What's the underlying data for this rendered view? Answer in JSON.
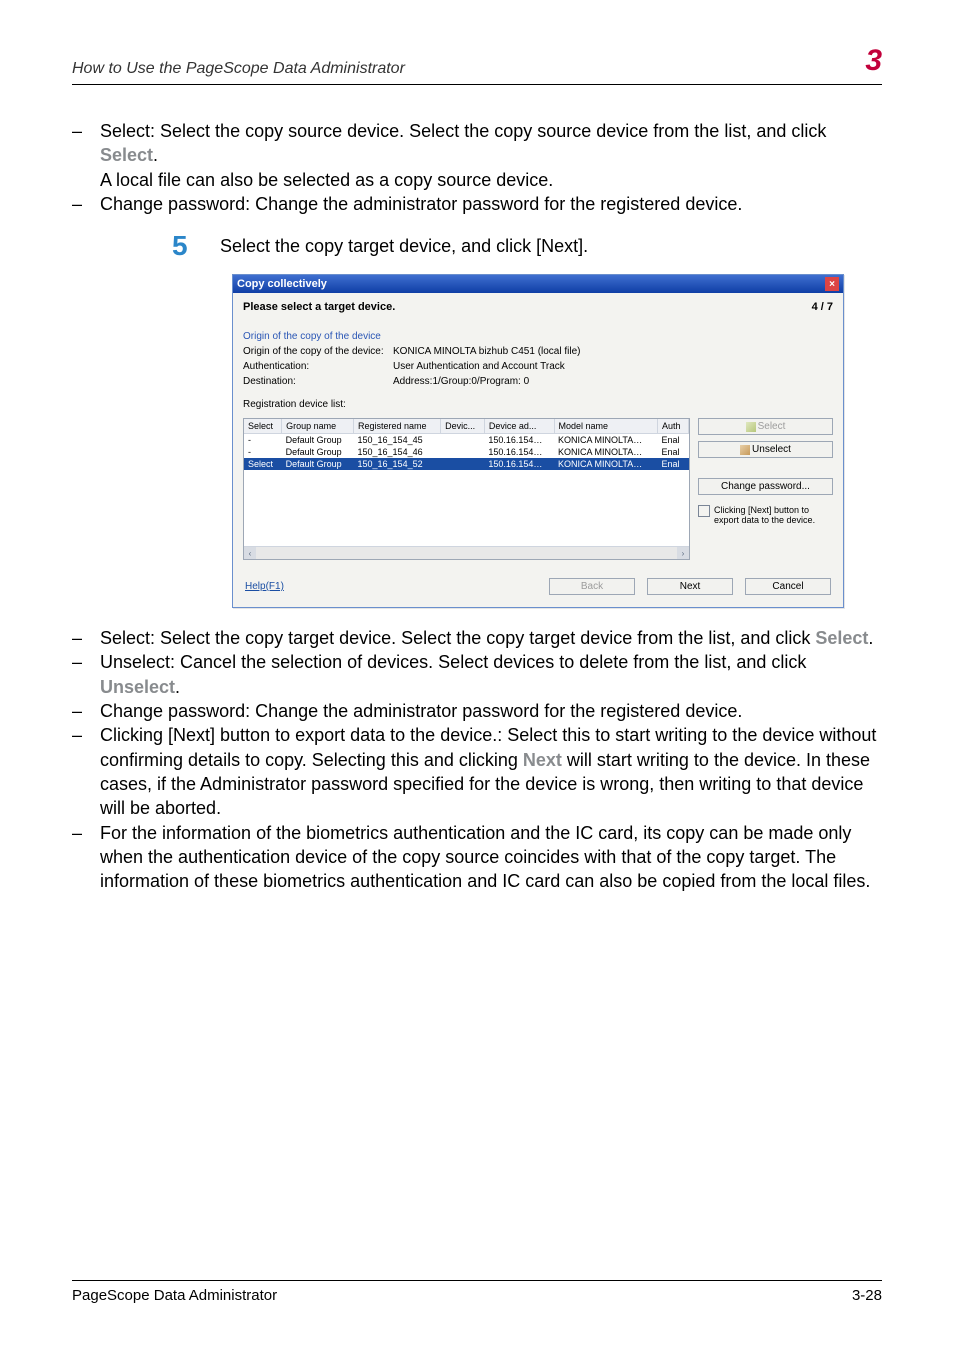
{
  "header": {
    "title": "How to Use the PageScope Data Administrator",
    "chapter_number": "3"
  },
  "top_list": {
    "item1_a": "Select: Select the copy source device. Select the copy source device from the list, and click ",
    "item1_keyword": "Select",
    "item1_b": ".",
    "item1_sub": "A local file can also be selected as a copy source device.",
    "item2": "Change password: Change the administrator password for the registered device."
  },
  "step": {
    "number": "5",
    "text": "Select the copy target device, and click [Next]."
  },
  "dialog": {
    "title": "Copy collectively",
    "close_glyph": "×",
    "subhead": "Please select a target device.",
    "step_counter": "4 / 7",
    "section_origin": "Origin of the copy of the device",
    "kv_origin_k": "Origin of the copy of the device:",
    "kv_origin_v": "KONICA MINOLTA bizhub C451 (local file)",
    "kv_auth_k": "Authentication:",
    "kv_auth_v": "User Authentication and Account Track",
    "kv_dest_k": "Destination:",
    "kv_dest_v": "Address:1/Group:0/Program: 0",
    "list_label": "Registration device list:",
    "columns": [
      "Select",
      "Group name",
      "Registered name",
      "Devic...",
      "Device ad...",
      "Model name",
      "Auth"
    ],
    "rows": [
      {
        "sel": "-",
        "group": "Default Group",
        "reg": "150_16_154_45",
        "dev": "",
        "addr": "150.16.154…",
        "model": "KONICA MINOLTA…",
        "auth": "Enal",
        "selected": false
      },
      {
        "sel": "-",
        "group": "Default Group",
        "reg": "150_16_154_46",
        "dev": "",
        "addr": "150.16.154…",
        "model": "KONICA MINOLTA…",
        "auth": "Enal",
        "selected": false
      },
      {
        "sel": "Select",
        "group": "Default Group",
        "reg": "150_16_154_52",
        "dev": "",
        "addr": "150.16.154…",
        "model": "KONICA MINOLTA…",
        "auth": "Enal",
        "selected": true
      }
    ],
    "btn_select": "Select",
    "btn_unselect": "Unselect",
    "btn_chpass": "Change password...",
    "chk_label": "Clicking [Next] button to export data to the device.",
    "help": "Help(F1)",
    "btn_back": "Back",
    "btn_next": "Next",
    "btn_cancel": "Cancel"
  },
  "bottom_list": {
    "i1a": "Select: Select the copy target device. Select the copy target device from the list, and click ",
    "i1k": "Select",
    "i1b": ".",
    "i2a": "Unselect: Cancel the selection of devices. Select devices to delete from the list, and click ",
    "i2k": "Unselect",
    "i2b": ".",
    "i3": "Change password: Change the administrator password for the registered device.",
    "i4a": "Clicking [Next] button to export data to the device.: Select this to start writing to the device without confirming details to copy. Selecting this and clicking ",
    "i4k": "Next",
    "i4b": " will start writing to the device. In these cases, if the Administrator password specified for the device is wrong, then writing to that device will be aborted.",
    "i5": "For the information of the biometrics authentication and the IC card, its copy can be made only when the authentication device of the copy source coincides with that of the copy target. The information of these biometrics authentication and IC card can also be copied from the local files."
  },
  "footer": {
    "left": "PageScope Data Administrator",
    "right": "3-28"
  }
}
